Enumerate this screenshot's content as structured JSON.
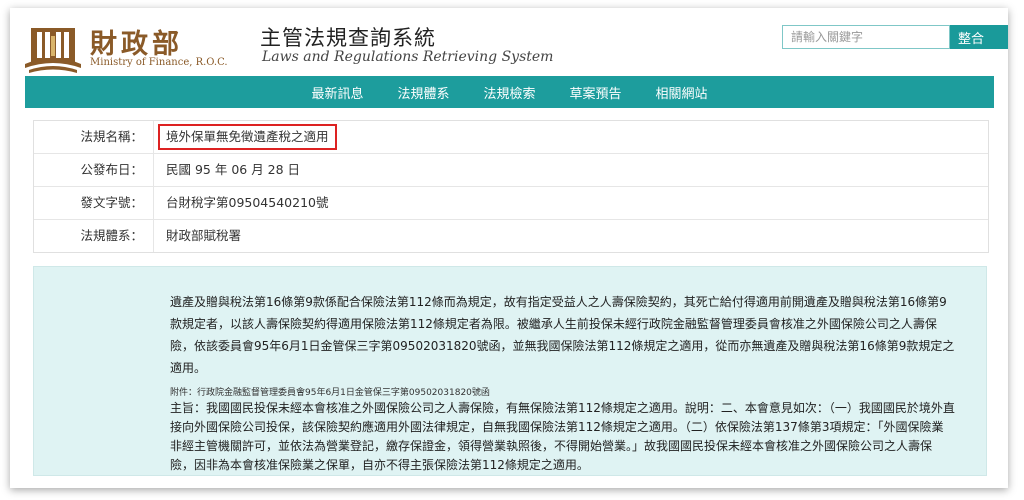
{
  "header": {
    "org_name_cn": "財政部",
    "org_name_en": "Ministry of Finance, R.O.C.",
    "system_name_cn": "主管法規查詢系統",
    "system_name_en": "Laws and Regulations Retrieving System",
    "search_placeholder": "請輸入關鍵字",
    "search_button": "整合"
  },
  "nav": {
    "items": [
      "最新訊息",
      "法規體系",
      "法規檢索",
      "草案預告",
      "相關網站"
    ]
  },
  "meta": {
    "rows": [
      {
        "label": "法規名稱：",
        "value": "境外保單無免徵遺產稅之適用"
      },
      {
        "label": "公發布日：",
        "value": "民國 95 年 06 月 28 日"
      },
      {
        "label": "發文字號：",
        "value": "台財稅字第09504540210號"
      },
      {
        "label": "法規體系：",
        "value": "財政部賦稅署"
      }
    ]
  },
  "content": {
    "paragraph": "遺產及贈與稅法第16條第9款係配合保險法第112條而為規定，故有指定受益人之人壽保險契約，其死亡給付得適用前開遺產及贈與稅法第16條第9款規定者，以該人壽保險契約得適用保險法第112條規定者為限。被繼承人生前投保未經行政院金融監督管理委員會核准之外國保險公司之人壽保險，依該委員會95年6月1日金管保三字第09502031820號函，並無我國保險法第112條規定之適用，從而亦無遺產及贈與稅法第16條第9款規定之適用。",
    "attachment_note": "附件：行政院金融監督管理委員會95年6月1日金管保三字第09502031820號函",
    "subject": "主旨：我國國民投保未經本會核准之外國保險公司之人壽保險，有無保險法第112條規定之適用。說明：二、本會意見如次：（一）我國國民於境外直接向外國保險公司投保，該保險契約應適用外國法律規定，自無我國保險法第112條規定之適用。（二）依保險法第137條第3項規定：「外國保險業非經主管機關許可，並依法為營業登記，繳存保證金，領得營業執照後，不得開始營業。」故我國國民投保未經本會核准之外國保險公司之人壽保險，因非為本會核准保險業之保單，自亦不得主張保險法第112條規定之適用。"
  },
  "colors": {
    "nav_bg": "#1d9d9d",
    "brand_brown": "#8a5a28",
    "content_bg": "#dff3f3",
    "highlight_border": "#d22222"
  }
}
